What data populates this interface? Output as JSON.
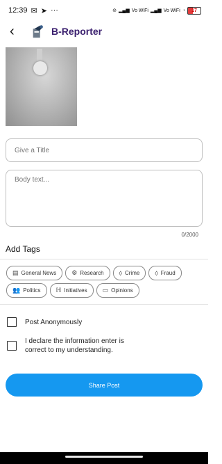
{
  "status_bar": {
    "time": "12:39",
    "network_labels": [
      "Vo WiFi",
      "Vo WiFi"
    ],
    "battery": "17"
  },
  "app_bar": {
    "title": "B-Reporter",
    "back_icon": "back-arrow-icon"
  },
  "form": {
    "title_placeholder": "Give a Title",
    "body_placeholder": "Body text...",
    "char_counter": "0/2000"
  },
  "tags": {
    "heading": "Add Tags",
    "items": [
      {
        "label": "General News",
        "icon": "newspaper-icon"
      },
      {
        "label": "Research",
        "icon": "gear-icon"
      },
      {
        "label": "Crime",
        "icon": "drop-icon"
      },
      {
        "label": "Fraud",
        "icon": "drop-icon"
      },
      {
        "label": "Politics",
        "icon": "people-icon"
      },
      {
        "label": "Initiatives",
        "icon": "initiatives-icon"
      },
      {
        "label": "Opinions",
        "icon": "comment-icon"
      }
    ]
  },
  "options": {
    "anonymous_label": "Post Anonymously",
    "declare_label": "I declare the information enter is correct to my understanding."
  },
  "actions": {
    "share_label": "Share Post"
  },
  "colors": {
    "accent": "#1598f0",
    "brand": "#3a1f6e"
  }
}
